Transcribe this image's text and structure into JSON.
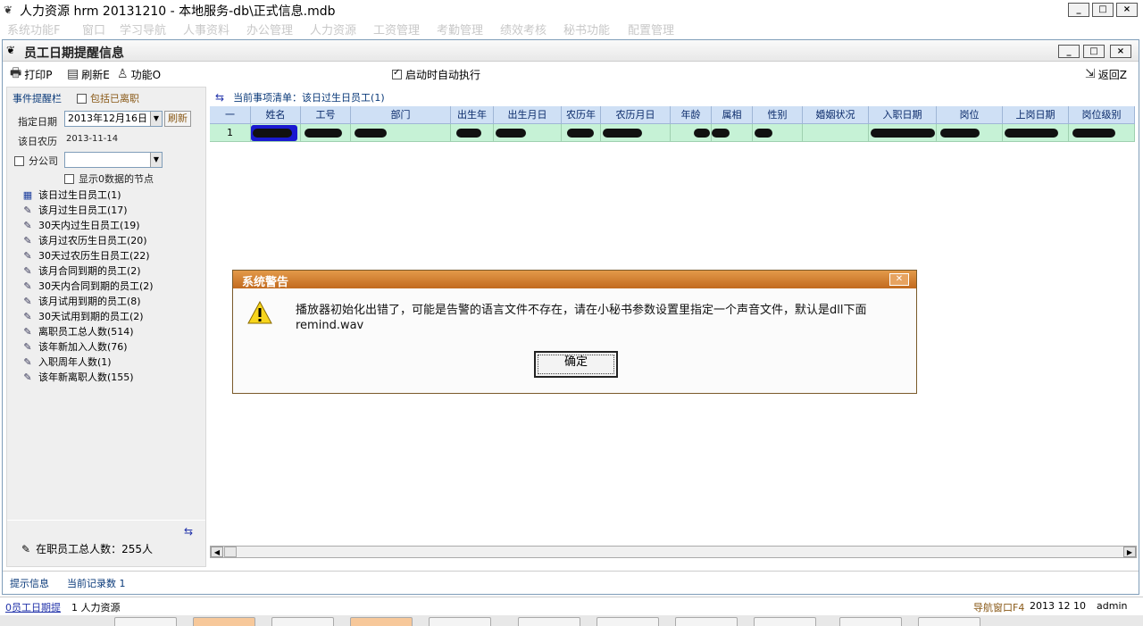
{
  "app": {
    "title": "人力资源 hrm 20131210 - 本地服务-db\\正式信息.mdb",
    "minimize": "_",
    "maximize": "□",
    "close": "×"
  },
  "menu": {
    "items": [
      "系统功能F",
      "窗口",
      "学习导航",
      "人事资料",
      "办公管理",
      "人力资源",
      "工资管理",
      "考勤管理",
      "绩效考核",
      "秘书功能",
      "配置管理"
    ]
  },
  "window": {
    "title": "员工日期提醒信息",
    "minimize": "_",
    "maximize": "□",
    "close": "×"
  },
  "toolbar": {
    "print": "打印P",
    "refresh": "刷新E",
    "function": "功能O",
    "auto_exec": "启动时自动执行",
    "auto_exec_checked": true,
    "back": "返回Z"
  },
  "left": {
    "event_header": "事件提醒栏",
    "include_resigned": "包括已离职",
    "date_label": "指定日期",
    "date_value": "2013年12月16日",
    "refresh_btn": "刷新",
    "lunar_label": "该日农历",
    "lunar_value": "2013-11-14",
    "branch_label": "分公司",
    "branch_value": "",
    "show_zero": "显示0数据的节点",
    "tree": [
      "该日过生日员工(1)",
      "该月过生日员工(17)",
      "30天内过生日员工(19)",
      "该月过农历生日员工(20)",
      "30天过农历生日员工(22)",
      "该月合同到期的员工(2)",
      "30天内合同到期的员工(2)",
      "该月试用到期的员工(8)",
      "30天试用到期的员工(2)",
      "离职员工总人数(514)",
      "该年新加入人数(76)",
      "入职周年人数(1)",
      "该年新离职人数(155)"
    ],
    "employee_total": "在职员工总人数：255人"
  },
  "right": {
    "current_item": "当前事项清单：该日过生日员工(1)",
    "columns": [
      "一",
      "姓名",
      "工号",
      "部门",
      "出生年",
      "出生月日",
      "农历年",
      "农历月日",
      "年龄",
      "属相",
      "性别",
      "婚姻状况",
      "入职日期",
      "岗位",
      "上岗日期",
      "岗位级别"
    ],
    "row_number": "1"
  },
  "inner_status": {
    "hint": "提示信息",
    "record_count": "当前记录数 1"
  },
  "app_status": {
    "left1": "0员工日期提",
    "left2": "1 人力资源",
    "nav": "导航窗口F4",
    "date": "2013 12 10",
    "user": "admin"
  },
  "dialog": {
    "title": "系统警告",
    "message": "播放器初始化出错了，可能是告警的语言文件不存在，请在小秘书参数设置里指定一个声音文件，默认是dll下面remind.wav",
    "ok": "确定"
  }
}
